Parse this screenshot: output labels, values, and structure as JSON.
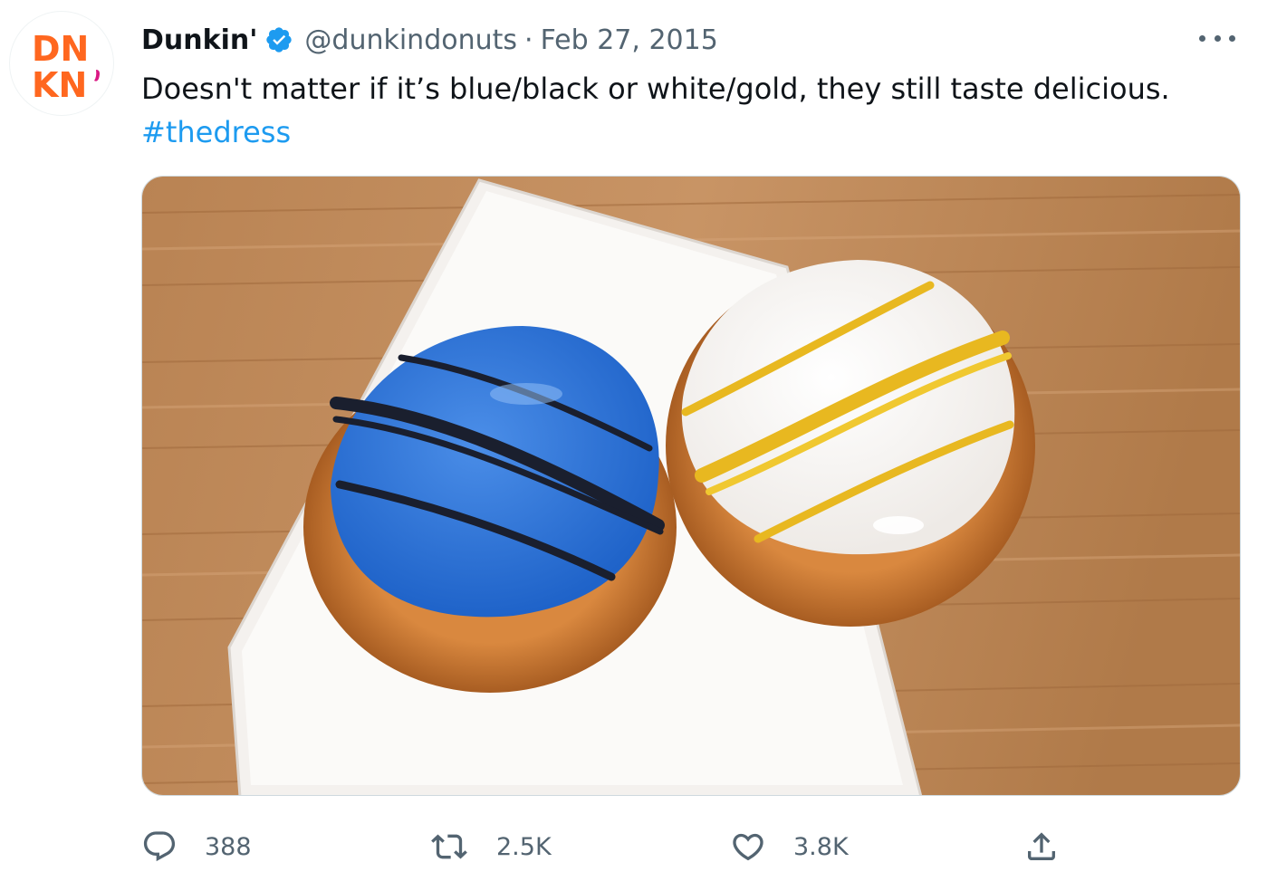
{
  "tweet": {
    "author_name": "Dunkin'",
    "handle": "@dunkindonuts",
    "separator": "·",
    "date": "Feb 27, 2015",
    "text": "Doesn't matter if it’s blue/black or white/gold, they still taste delicious.",
    "hashtag": "#thedress"
  },
  "avatar": {
    "logo_line1": "DN",
    "logo_line2": "KN"
  },
  "actions": {
    "replies": "388",
    "retweets": "2.5K",
    "likes": "3.8K"
  },
  "icons": {
    "verified": "verified-badge-icon",
    "more": "more-options-icon",
    "reply": "reply-icon",
    "retweet": "retweet-icon",
    "like": "heart-icon",
    "share": "share-icon"
  },
  "colors": {
    "brand_orange": "#ff671f",
    "brand_pink": "#da1884",
    "link_blue": "#1d9bf0",
    "secondary_text": "#536471"
  }
}
